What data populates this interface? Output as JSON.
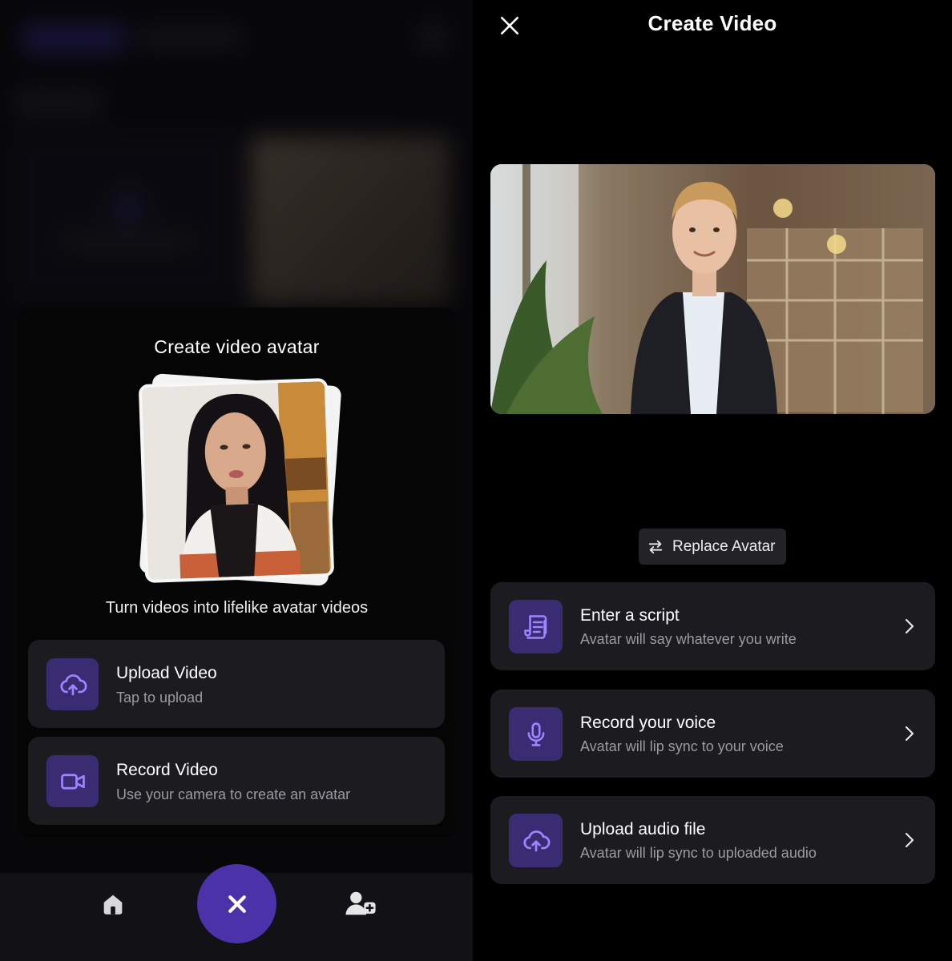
{
  "left": {
    "sheet": {
      "title": "Create video avatar",
      "subtitle": "Turn videos into lifelike avatar videos",
      "options": [
        {
          "title": "Upload Video",
          "subtitle": "Tap to upload",
          "icon": "cloud-upload-icon"
        },
        {
          "title": "Record Video",
          "subtitle": "Use your camera to create an avatar",
          "icon": "video-camera-icon"
        }
      ]
    },
    "nav": {
      "home_icon": "home-icon",
      "close_icon": "close-icon",
      "add_user_icon": "add-user-icon"
    }
  },
  "right": {
    "title": "Create Video",
    "replace_label": "Replace Avatar",
    "options": [
      {
        "title": "Enter a script",
        "subtitle": "Avatar will say whatever you write",
        "icon": "script-icon"
      },
      {
        "title": "Record your voice",
        "subtitle": "Avatar will lip sync to your voice",
        "icon": "microphone-icon"
      },
      {
        "title": "Upload audio file",
        "subtitle": "Avatar will lip sync to uploaded audio",
        "icon": "cloud-upload-icon"
      }
    ]
  },
  "colors": {
    "accent": "#4b32a8",
    "icon_bg": "#3a2c73",
    "icon_fg": "#9b86ff",
    "card_bg": "#1c1b1f"
  }
}
